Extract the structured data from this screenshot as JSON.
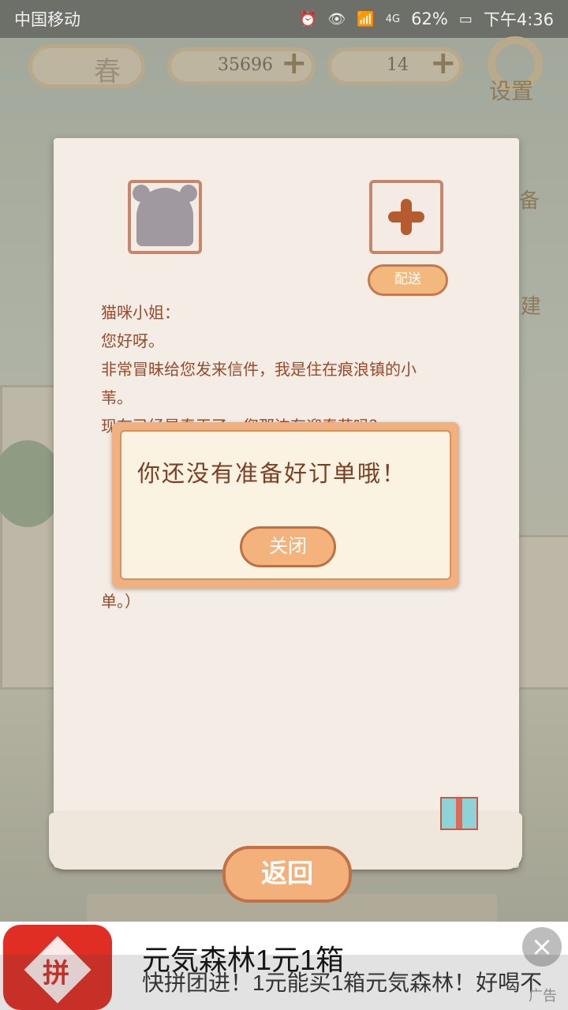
{
  "status_bar": {
    "carrier": "中国移动",
    "network": "4G",
    "battery": "62%",
    "time": "下午4:36"
  },
  "hud": {
    "season": "春",
    "fish_count": "35696",
    "cheese_count": "14",
    "settings_label": "设置",
    "side_labels": [
      "备",
      "建"
    ]
  },
  "letter": {
    "deliver_label": "配送",
    "lines": [
      "猫咪小姐：",
      "您好呀。",
      "非常冒昧给您发来信件，我是住在痕浪镇的小",
      "苇。",
      "现在已经是春天了，您那边有迎春花吗？",
      "单。）"
    ]
  },
  "dialog": {
    "message": "你还没有准备好订单哦！",
    "close_label": "关闭"
  },
  "back_label": "返回",
  "ad": {
    "title": "元気森林1元1箱",
    "description": "快拼团进！1元能买1箱元気森林！好喝不",
    "tag": "广告",
    "logo_text": "拼",
    "close_icon": "×"
  },
  "colors": {
    "accent": "#f2b07c",
    "text_brown": "#9a4a2a",
    "ad_red": "#e02e24"
  }
}
